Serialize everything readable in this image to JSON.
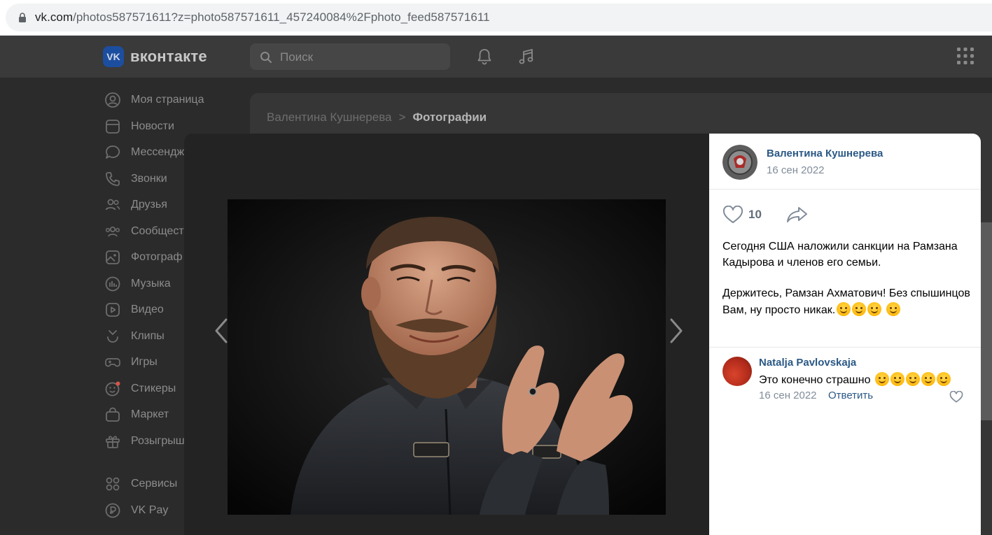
{
  "browser": {
    "url_host": "vk.com",
    "url_rest": "/photos587571611?z=photo587571611_457240084%2Fphoto_feed587571611"
  },
  "header": {
    "logo_badge": "VK",
    "logo_text": "вконтакте",
    "search_placeholder": "Поиск"
  },
  "sidebar": {
    "items": [
      {
        "label": "Моя страница",
        "icon": "profile-icon"
      },
      {
        "label": "Новости",
        "icon": "news-icon"
      },
      {
        "label": "Мессендж",
        "icon": "messenger-icon"
      },
      {
        "label": "Звонки",
        "icon": "phone-icon"
      },
      {
        "label": "Друзья",
        "icon": "friends-icon"
      },
      {
        "label": "Сообщест",
        "icon": "communities-icon"
      },
      {
        "label": "Фотограф",
        "icon": "photos-icon"
      },
      {
        "label": "Музыка",
        "icon": "music-icon"
      },
      {
        "label": "Видео",
        "icon": "video-icon"
      },
      {
        "label": "Клипы",
        "icon": "clips-icon"
      },
      {
        "label": "Игры",
        "icon": "games-icon"
      },
      {
        "label": "Стикеры",
        "icon": "stickers-icon"
      },
      {
        "label": "Маркет",
        "icon": "market-icon"
      },
      {
        "label": "Розыгрыш",
        "icon": "gifts-icon"
      },
      {
        "label": "Сервисы",
        "icon": "services-icon"
      },
      {
        "label": "VK Pay",
        "icon": "vkpay-icon"
      }
    ]
  },
  "breadcrumb": {
    "owner": "Валентина Кушнерева",
    "separator": ">",
    "current": "Фотографии"
  },
  "post": {
    "author": "Валентина Кушнерева",
    "date": "16 сен 2022",
    "likes": "10",
    "text_p1": "Сегодня США наложили санкции на Рамзана Кадырова и членов его семьи.",
    "text_p2": "Держитесь, Рамзан Ахматович! Без спышинцов Вам, ну просто никак."
  },
  "comment": {
    "author": "Natalja Pavlovskaja",
    "text": "Это конечно страшно",
    "date": "16 сен 2022",
    "reply_label": "Ответить"
  },
  "colors": {
    "link": "#2a5885",
    "muted": "#818c99",
    "vk_blue": "#0077ff"
  }
}
